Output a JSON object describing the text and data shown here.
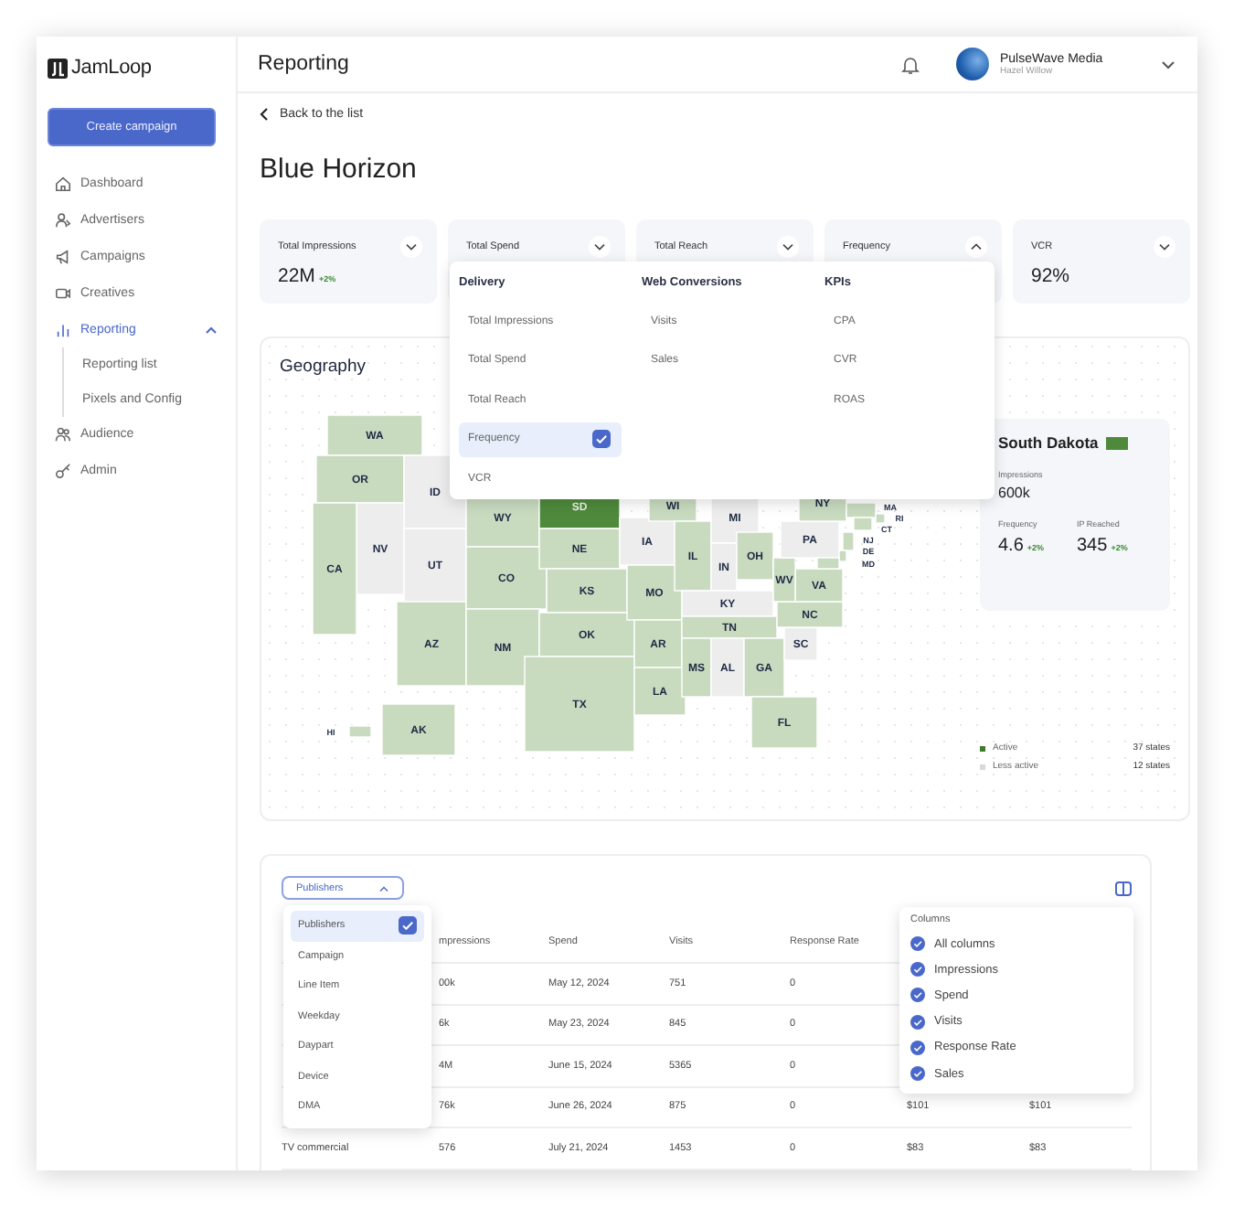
{
  "sidebar": {
    "logo": "JamLoop",
    "create_button": "Create campaign",
    "items": [
      {
        "label": "Dashboard",
        "selected": false
      },
      {
        "label": "Advertisers",
        "selected": false
      },
      {
        "label": "Campaigns",
        "selected": false
      },
      {
        "label": "Creatives",
        "selected": false
      },
      {
        "label": "Reporting",
        "selected": true,
        "expanded": true,
        "children": [
          {
            "label": "Reporting list"
          },
          {
            "label": "Pixels and Config"
          }
        ]
      },
      {
        "label": "Audience",
        "selected": false
      },
      {
        "label": "Admin",
        "selected": false
      }
    ]
  },
  "header": {
    "title": "Reporting",
    "account": "PulseWave Media",
    "user": "Hazel Willow"
  },
  "back_link": "Back to the list",
  "page_title": "Blue Horizon",
  "kpis": [
    {
      "label": "Total Impressions",
      "value": "22M",
      "change": "+2%",
      "expanded": false
    },
    {
      "label": "Total Spend",
      "expanded": false
    },
    {
      "label": "Total Reach",
      "expanded": false
    },
    {
      "label": "Frequency",
      "expanded": true
    },
    {
      "label": "VCR",
      "value": "92%",
      "expanded": false
    }
  ],
  "metric_menu": [
    {
      "heading": "Delivery",
      "items": [
        {
          "label": "Total Impressions",
          "selected": false
        },
        {
          "label": "Total Spend",
          "selected": false
        },
        {
          "label": "Total Reach",
          "selected": false
        },
        {
          "label": "Frequency",
          "selected": true
        },
        {
          "label": "VCR",
          "selected": false
        }
      ]
    },
    {
      "heading": "Web Conversions",
      "items": [
        {
          "label": "Visits",
          "selected": false
        },
        {
          "label": "Sales",
          "selected": false
        }
      ]
    },
    {
      "heading": "KPIs",
      "items": [
        {
          "label": "CPA",
          "selected": false
        },
        {
          "label": "CVR",
          "selected": false
        },
        {
          "label": "ROAS",
          "selected": false
        }
      ]
    }
  ],
  "geography": {
    "title": "Geography",
    "map": {
      "states": [
        {
          "label": "WA",
          "active": true,
          "selected": false
        },
        {
          "label": "OR",
          "active": true,
          "selected": false
        },
        {
          "label": "ID",
          "active": false,
          "selected": false
        },
        {
          "label": "NV",
          "active": false,
          "selected": false
        },
        {
          "label": "CA",
          "active": true,
          "selected": false
        },
        {
          "label": "UT",
          "active": false,
          "selected": false
        },
        {
          "label": "AZ",
          "active": true,
          "selected": false
        },
        {
          "label": "WY",
          "active": true,
          "selected": false
        },
        {
          "label": "CO",
          "active": true,
          "selected": false
        },
        {
          "label": "NM",
          "active": true,
          "selected": false
        },
        {
          "label": "SD",
          "active": true,
          "selected": true
        },
        {
          "label": "NE",
          "active": true,
          "selected": false
        },
        {
          "label": "KS",
          "active": true,
          "selected": false
        },
        {
          "label": "OK",
          "active": true,
          "selected": false
        },
        {
          "label": "TX",
          "active": true,
          "selected": false
        },
        {
          "label": "IA",
          "active": false,
          "selected": false
        },
        {
          "label": "MO",
          "active": true,
          "selected": false
        },
        {
          "label": "AR",
          "active": true,
          "selected": false
        },
        {
          "label": "LA",
          "active": true,
          "selected": false
        },
        {
          "label": "WI",
          "active": true,
          "selected": false
        },
        {
          "label": "IL",
          "active": true,
          "selected": false
        },
        {
          "label": "MI",
          "active": false,
          "selected": false
        },
        {
          "label": "IN",
          "active": false,
          "selected": false
        },
        {
          "label": "OH",
          "active": true,
          "selected": false
        },
        {
          "label": "KY",
          "active": false,
          "selected": false
        },
        {
          "label": "TN",
          "active": true,
          "selected": false
        },
        {
          "label": "MS",
          "active": true,
          "selected": false
        },
        {
          "label": "AL",
          "active": false,
          "selected": false
        },
        {
          "label": "GA",
          "active": true,
          "selected": false
        },
        {
          "label": "FL",
          "active": true,
          "selected": false
        },
        {
          "label": "SC",
          "active": false,
          "selected": false
        },
        {
          "label": "NC",
          "active": true,
          "selected": false
        },
        {
          "label": "VA",
          "active": true,
          "selected": false
        },
        {
          "label": "WV",
          "active": true,
          "selected": false
        },
        {
          "label": "PA",
          "active": false,
          "selected": false
        },
        {
          "label": "NY",
          "active": true,
          "selected": false
        },
        {
          "label": "MA",
          "active": true,
          "selected": false
        },
        {
          "label": "RI",
          "active": true,
          "selected": false
        },
        {
          "label": "CT",
          "active": true,
          "selected": false
        },
        {
          "label": "NJ",
          "active": true,
          "selected": false
        },
        {
          "label": "DE",
          "active": true,
          "selected": false
        },
        {
          "label": "MD",
          "active": true,
          "selected": false
        },
        {
          "label": "AK",
          "active": true,
          "selected": false
        },
        {
          "label": "HI",
          "active": true,
          "selected": false
        }
      ]
    },
    "detail": {
      "name": "South Dakota",
      "impressions_label": "Impressions",
      "impressions": "600k",
      "stats": [
        {
          "label": "Frequency",
          "value": "4.6",
          "change": "+2%"
        },
        {
          "label": "IP Reached",
          "value": "345",
          "change": "+2%"
        }
      ]
    },
    "legend": [
      {
        "label": "Active",
        "count": "37 states",
        "color": "#3f7a2e"
      },
      {
        "label": "Less active",
        "count": "12 states",
        "color": "#d9d9d9"
      }
    ]
  },
  "table": {
    "group_by": {
      "label": "Publishers",
      "expanded": true,
      "options": [
        {
          "label": "Publishers",
          "selected": true
        },
        {
          "label": "Campaign",
          "selected": false
        },
        {
          "label": "Line Item",
          "selected": false
        },
        {
          "label": "Weekday",
          "selected": false
        },
        {
          "label": "Daypart",
          "selected": false
        },
        {
          "label": "Device",
          "selected": false
        },
        {
          "label": "DMA",
          "selected": false
        }
      ]
    },
    "columns_menu": {
      "title": "Columns",
      "items": [
        {
          "label": "All columns",
          "checked": true
        },
        {
          "label": "Impressions",
          "checked": true
        },
        {
          "label": "Spend",
          "checked": true
        },
        {
          "label": "Visits",
          "checked": true
        },
        {
          "label": "Response Rate",
          "checked": true
        },
        {
          "label": "Sales",
          "checked": true
        }
      ]
    },
    "columns": {
      "column_2": "mpressions",
      "spend": "Spend",
      "visits": "Visits",
      "response_rate": "Response Rate"
    },
    "rows": [
      {
        "column_2": "00k",
        "spend": "May 12, 2024",
        "visits": "751",
        "response_rate": "0"
      },
      {
        "column_2": "6k",
        "spend": "May 23, 2024",
        "visits": "845",
        "response_rate": "0"
      },
      {
        "column_2": "4M",
        "spend": "June 15, 2024",
        "visits": "5365",
        "response_rate": "0"
      },
      {
        "column_2": "76k",
        "spend": "June 26, 2024",
        "visits": "875",
        "response_rate": "0",
        "column_6": "$101",
        "column_7": "$101"
      },
      {
        "column_1": "TV commercial",
        "column_2": "576",
        "spend": "July 21, 2024",
        "visits": "1453",
        "response_rate": "0",
        "column_6": "$83",
        "column_7": "$83"
      }
    ]
  }
}
